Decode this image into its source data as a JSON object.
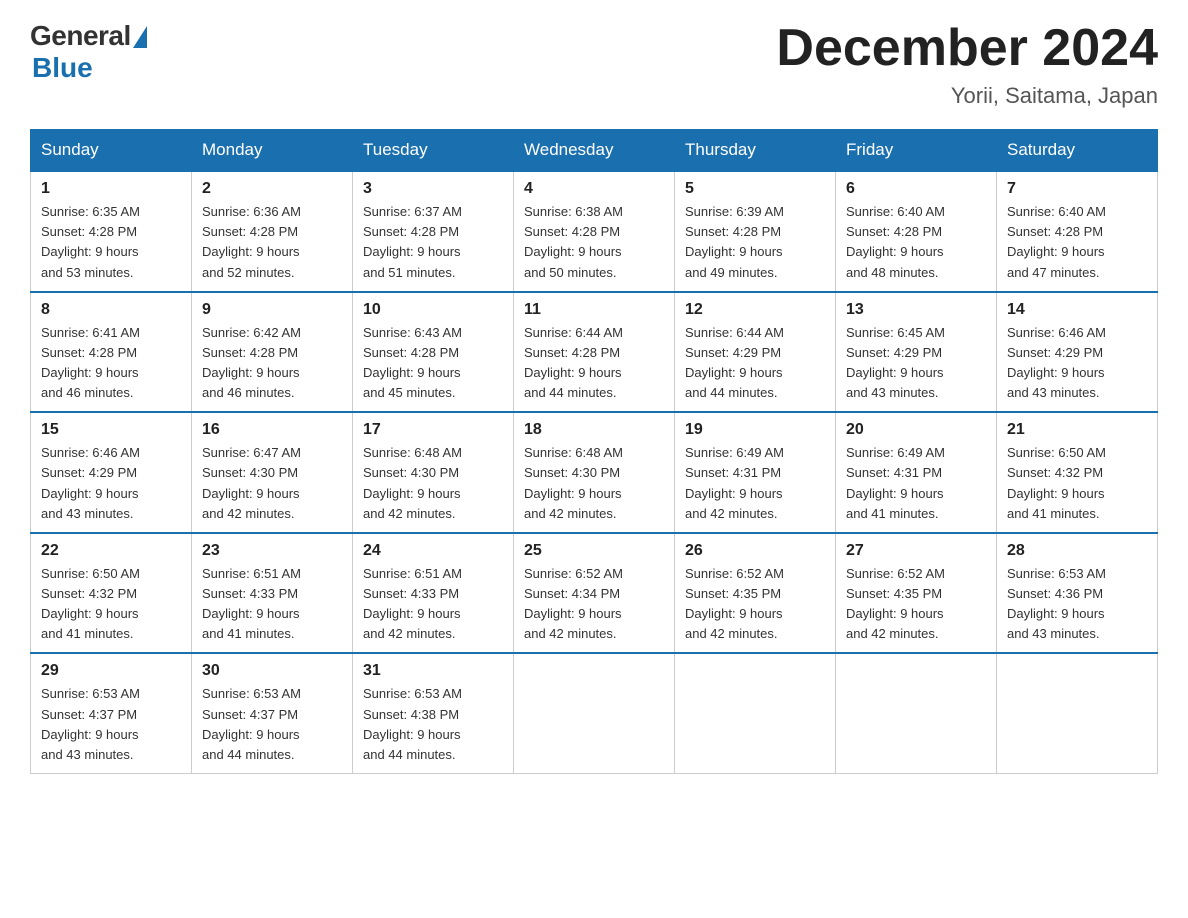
{
  "logo": {
    "general": "General",
    "blue": "Blue"
  },
  "title": "December 2024",
  "subtitle": "Yorii, Saitama, Japan",
  "days_of_week": [
    "Sunday",
    "Monday",
    "Tuesday",
    "Wednesday",
    "Thursday",
    "Friday",
    "Saturday"
  ],
  "weeks": [
    [
      {
        "day": "1",
        "sunrise": "6:35 AM",
        "sunset": "4:28 PM",
        "daylight": "9 hours and 53 minutes."
      },
      {
        "day": "2",
        "sunrise": "6:36 AM",
        "sunset": "4:28 PM",
        "daylight": "9 hours and 52 minutes."
      },
      {
        "day": "3",
        "sunrise": "6:37 AM",
        "sunset": "4:28 PM",
        "daylight": "9 hours and 51 minutes."
      },
      {
        "day": "4",
        "sunrise": "6:38 AM",
        "sunset": "4:28 PM",
        "daylight": "9 hours and 50 minutes."
      },
      {
        "day": "5",
        "sunrise": "6:39 AM",
        "sunset": "4:28 PM",
        "daylight": "9 hours and 49 minutes."
      },
      {
        "day": "6",
        "sunrise": "6:40 AM",
        "sunset": "4:28 PM",
        "daylight": "9 hours and 48 minutes."
      },
      {
        "day": "7",
        "sunrise": "6:40 AM",
        "sunset": "4:28 PM",
        "daylight": "9 hours and 47 minutes."
      }
    ],
    [
      {
        "day": "8",
        "sunrise": "6:41 AM",
        "sunset": "4:28 PM",
        "daylight": "9 hours and 46 minutes."
      },
      {
        "day": "9",
        "sunrise": "6:42 AM",
        "sunset": "4:28 PM",
        "daylight": "9 hours and 46 minutes."
      },
      {
        "day": "10",
        "sunrise": "6:43 AM",
        "sunset": "4:28 PM",
        "daylight": "9 hours and 45 minutes."
      },
      {
        "day": "11",
        "sunrise": "6:44 AM",
        "sunset": "4:28 PM",
        "daylight": "9 hours and 44 minutes."
      },
      {
        "day": "12",
        "sunrise": "6:44 AM",
        "sunset": "4:29 PM",
        "daylight": "9 hours and 44 minutes."
      },
      {
        "day": "13",
        "sunrise": "6:45 AM",
        "sunset": "4:29 PM",
        "daylight": "9 hours and 43 minutes."
      },
      {
        "day": "14",
        "sunrise": "6:46 AM",
        "sunset": "4:29 PM",
        "daylight": "9 hours and 43 minutes."
      }
    ],
    [
      {
        "day": "15",
        "sunrise": "6:46 AM",
        "sunset": "4:29 PM",
        "daylight": "9 hours and 43 minutes."
      },
      {
        "day": "16",
        "sunrise": "6:47 AM",
        "sunset": "4:30 PM",
        "daylight": "9 hours and 42 minutes."
      },
      {
        "day": "17",
        "sunrise": "6:48 AM",
        "sunset": "4:30 PM",
        "daylight": "9 hours and 42 minutes."
      },
      {
        "day": "18",
        "sunrise": "6:48 AM",
        "sunset": "4:30 PM",
        "daylight": "9 hours and 42 minutes."
      },
      {
        "day": "19",
        "sunrise": "6:49 AM",
        "sunset": "4:31 PM",
        "daylight": "9 hours and 42 minutes."
      },
      {
        "day": "20",
        "sunrise": "6:49 AM",
        "sunset": "4:31 PM",
        "daylight": "9 hours and 41 minutes."
      },
      {
        "day": "21",
        "sunrise": "6:50 AM",
        "sunset": "4:32 PM",
        "daylight": "9 hours and 41 minutes."
      }
    ],
    [
      {
        "day": "22",
        "sunrise": "6:50 AM",
        "sunset": "4:32 PM",
        "daylight": "9 hours and 41 minutes."
      },
      {
        "day": "23",
        "sunrise": "6:51 AM",
        "sunset": "4:33 PM",
        "daylight": "9 hours and 41 minutes."
      },
      {
        "day": "24",
        "sunrise": "6:51 AM",
        "sunset": "4:33 PM",
        "daylight": "9 hours and 42 minutes."
      },
      {
        "day": "25",
        "sunrise": "6:52 AM",
        "sunset": "4:34 PM",
        "daylight": "9 hours and 42 minutes."
      },
      {
        "day": "26",
        "sunrise": "6:52 AM",
        "sunset": "4:35 PM",
        "daylight": "9 hours and 42 minutes."
      },
      {
        "day": "27",
        "sunrise": "6:52 AM",
        "sunset": "4:35 PM",
        "daylight": "9 hours and 42 minutes."
      },
      {
        "day": "28",
        "sunrise": "6:53 AM",
        "sunset": "4:36 PM",
        "daylight": "9 hours and 43 minutes."
      }
    ],
    [
      {
        "day": "29",
        "sunrise": "6:53 AM",
        "sunset": "4:37 PM",
        "daylight": "9 hours and 43 minutes."
      },
      {
        "day": "30",
        "sunrise": "6:53 AM",
        "sunset": "4:37 PM",
        "daylight": "9 hours and 44 minutes."
      },
      {
        "day": "31",
        "sunrise": "6:53 AM",
        "sunset": "4:38 PM",
        "daylight": "9 hours and 44 minutes."
      },
      null,
      null,
      null,
      null
    ]
  ],
  "labels": {
    "sunrise": "Sunrise:",
    "sunset": "Sunset:",
    "daylight": "Daylight:"
  }
}
